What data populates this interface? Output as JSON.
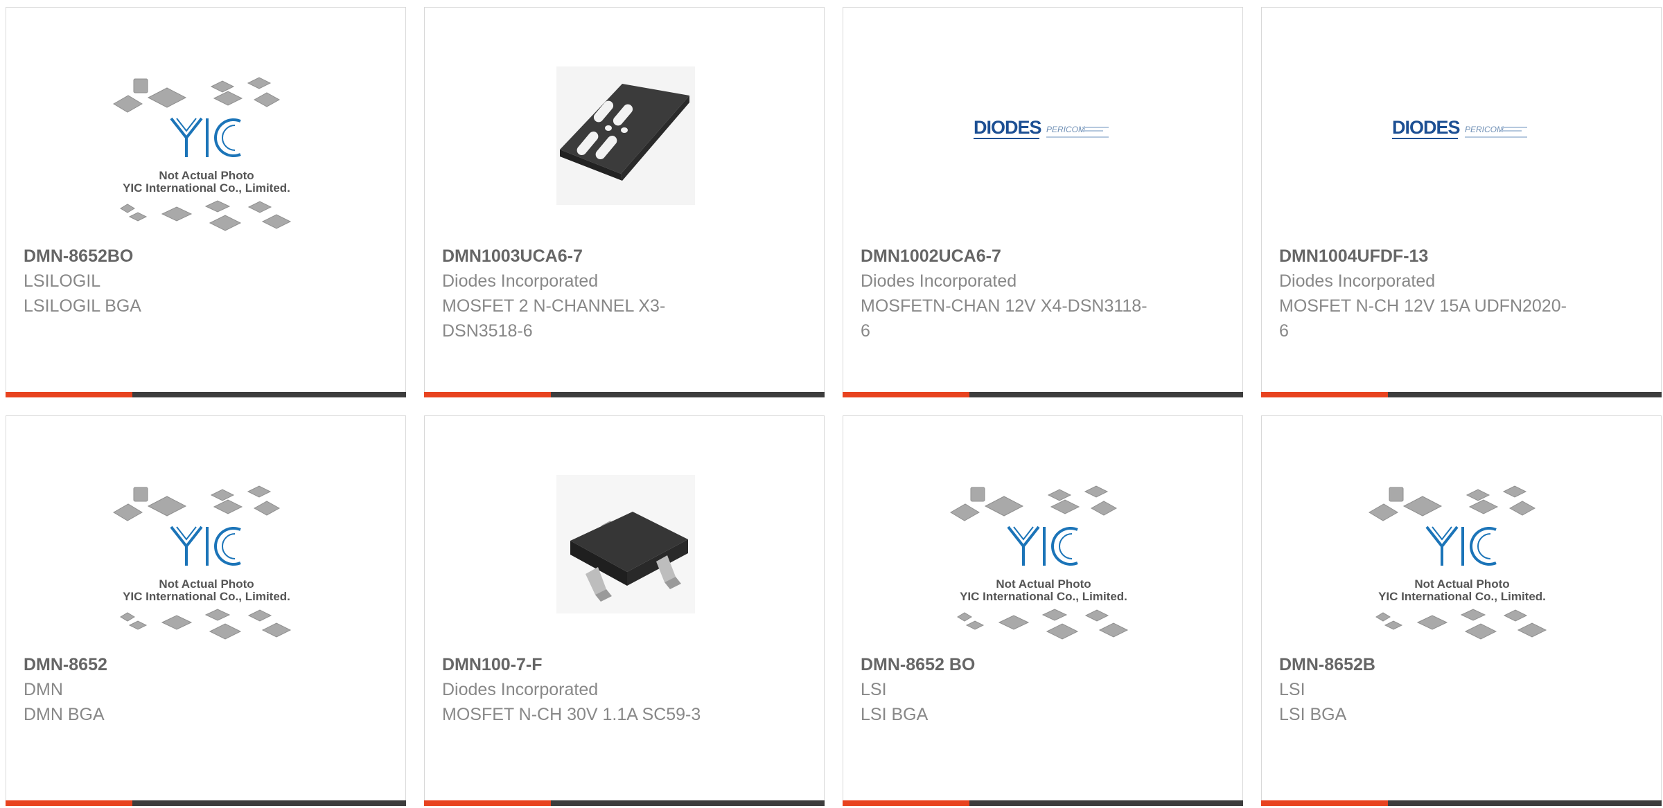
{
  "accent_color": "#e8431f",
  "bar_color": "#3d3d3d",
  "placeholder_caption": {
    "line1": "Not Actual Photo",
    "line2": "YIC International Co., Limited.",
    "logo_text": "YIC"
  },
  "diodes_logo": {
    "brand": "DIODES",
    "sub": "PERICOM"
  },
  "products": [
    {
      "part_number": "DMN-8652BO",
      "manufacturer": "LSILOGIL",
      "description": "LSILOGIL BGA",
      "image": "yic-placeholder"
    },
    {
      "part_number": "DMN1003UCA6-7",
      "manufacturer": "Diodes Incorporated",
      "description": "MOSFET 2 N-CHANNEL X3-DSN3518-6",
      "image": "chip-x3-dsn"
    },
    {
      "part_number": "DMN1002UCA6-7",
      "manufacturer": "Diodes Incorporated",
      "description": "MOSFETN-CHAN 12V X4-DSN3118-6",
      "image": "diodes-logo"
    },
    {
      "part_number": "DMN1004UFDF-13",
      "manufacturer": "Diodes Incorporated",
      "description": "MOSFET N-CH 12V 15A UDFN2020-6",
      "image": "diodes-logo"
    },
    {
      "part_number": "DMN-8652",
      "manufacturer": "DMN",
      "description": "DMN BGA",
      "image": "yic-placeholder"
    },
    {
      "part_number": "DMN100-7-F",
      "manufacturer": "Diodes Incorporated",
      "description": "MOSFET N-CH 30V 1.1A SC59-3",
      "image": "chip-sc59"
    },
    {
      "part_number": "DMN-8652 BO",
      "manufacturer": "LSI",
      "description": "LSI BGA",
      "image": "yic-placeholder"
    },
    {
      "part_number": "DMN-8652B",
      "manufacturer": "LSI",
      "description": "LSI BGA",
      "image": "yic-placeholder"
    }
  ]
}
